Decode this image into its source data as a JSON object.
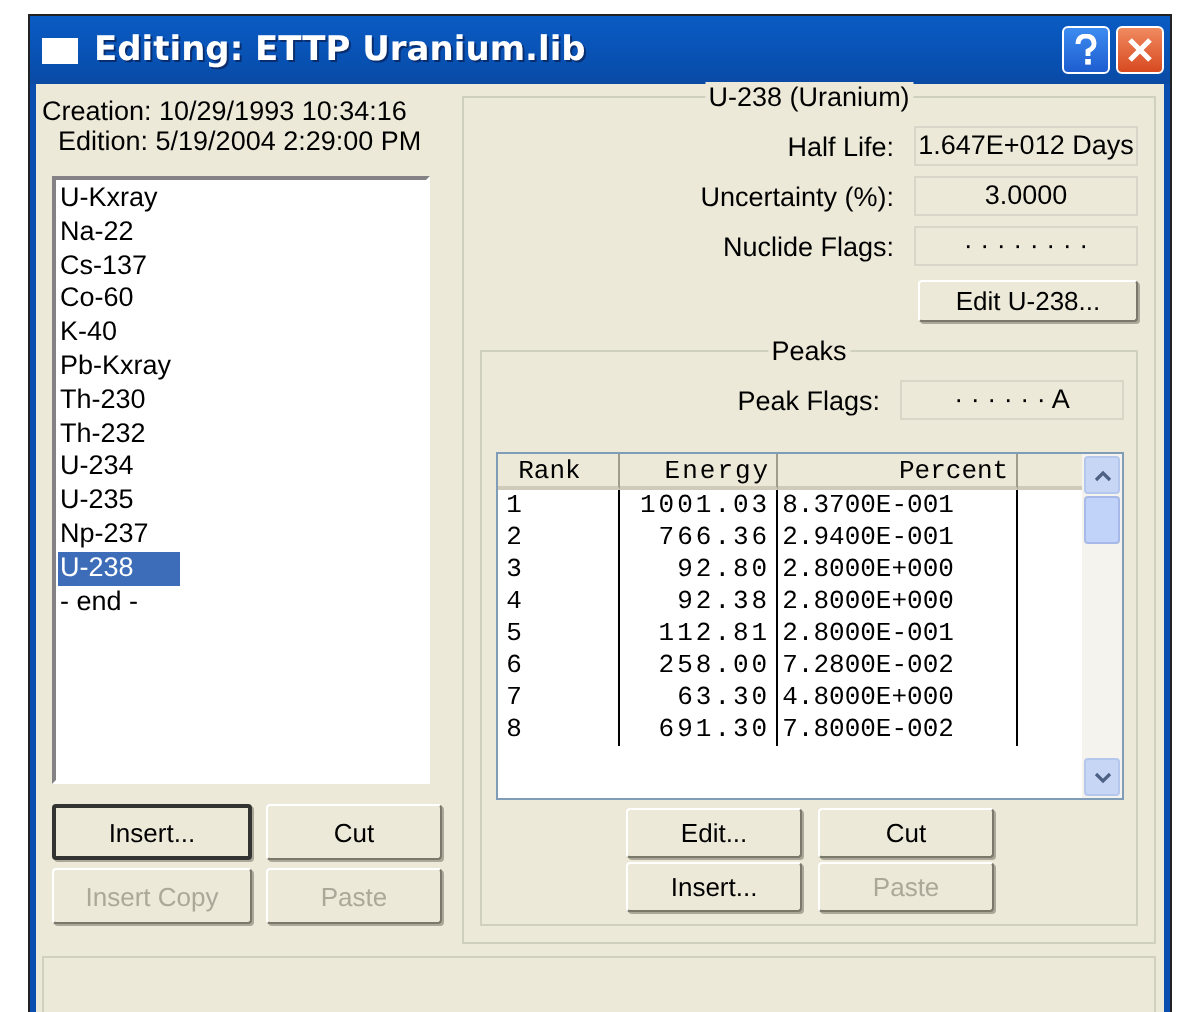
{
  "window": {
    "title": "Editing: ETTP Uranium.lib"
  },
  "file_info": {
    "creation": "Creation: 10/29/1993  10:34:16",
    "edition": "Edition: 5/19/2004  2:29:00 PM"
  },
  "nuclides": [
    {
      "label": "U-Kxray",
      "selected": false
    },
    {
      "label": "Na-22",
      "selected": false
    },
    {
      "label": "Cs-137",
      "selected": false
    },
    {
      "label": "Co-60",
      "selected": false
    },
    {
      "label": "K-40",
      "selected": false
    },
    {
      "label": "Pb-Kxray",
      "selected": false
    },
    {
      "label": "Th-230",
      "selected": false
    },
    {
      "label": "Th-232",
      "selected": false
    },
    {
      "label": "U-234",
      "selected": false
    },
    {
      "label": "U-235",
      "selected": false
    },
    {
      "label": "Np-237",
      "selected": false
    },
    {
      "label": "U-238",
      "selected": true
    },
    {
      "label": "- end -",
      "selected": false
    }
  ],
  "list_buttons": [
    {
      "label": "Insert...",
      "disabled": false,
      "default": true
    },
    {
      "label": "Cut",
      "disabled": false,
      "default": false
    },
    {
      "label": "Insert Copy",
      "disabled": true,
      "default": false
    },
    {
      "label": "Paste",
      "disabled": true,
      "default": false
    }
  ],
  "nuclide_group": {
    "title": "U-238 (Uranium)",
    "fields": [
      {
        "label": "Half Life:",
        "value": "1.647E+012 Days"
      },
      {
        "label": "Uncertainty (%):",
        "value": "3.0000"
      },
      {
        "label": "Nuclide Flags:",
        "value": "· · · · · · · ·"
      }
    ],
    "edit_button": "Edit U-238..."
  },
  "peaks_group": {
    "title": "Peaks",
    "flags_label": "Peak Flags:",
    "flags_value": "· · · · · · A",
    "table": {
      "columns": [
        "Rank",
        "Energy",
        "Percent"
      ],
      "rows": [
        [
          "1",
          "1001.03",
          "8.3700E-001"
        ],
        [
          "2",
          "766.36",
          "2.9400E-001"
        ],
        [
          "3",
          "92.80",
          "2.8000E+000"
        ],
        [
          "4",
          "92.38",
          "2.8000E+000"
        ],
        [
          "5",
          "112.81",
          "2.8000E-001"
        ],
        [
          "6",
          "258.00",
          "7.2800E-002"
        ],
        [
          "7",
          "63.30",
          "4.8000E+000"
        ],
        [
          "8",
          "691.30",
          "7.8000E-002"
        ]
      ]
    },
    "buttons": [
      {
        "label": "Edit...",
        "disabled": false
      },
      {
        "label": "Cut",
        "disabled": false
      },
      {
        "label": "Insert...",
        "disabled": false
      },
      {
        "label": "Paste",
        "disabled": true
      }
    ]
  }
}
